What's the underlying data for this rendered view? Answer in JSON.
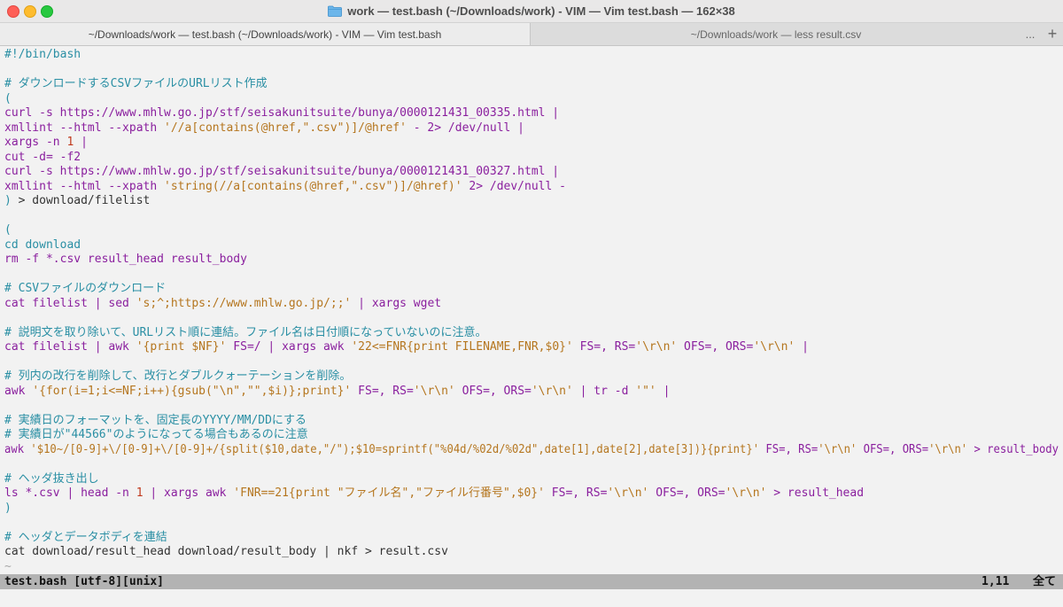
{
  "window": {
    "title": "work — test.bash (~/Downloads/work) - VIM — Vim test.bash — 162×38",
    "icon": "folder-icon"
  },
  "tabs": [
    {
      "label": "~/Downloads/work — test.bash (~/Downloads/work) - VIM — Vim test.bash"
    },
    {
      "label": "~/Downloads/work — less result.csv"
    }
  ],
  "tab_actions": {
    "overflow": "...",
    "new_tab": "+"
  },
  "colors": {
    "comment": "#2a8fa4",
    "keyword": "#2a8fa4",
    "string": "#b5761f",
    "command": "#8a1f9e",
    "number": "#c03a1e",
    "text": "#333333",
    "tilde": "#a8a8a8"
  },
  "editor": {
    "lines": [
      [
        [
          "#!/bin/bash",
          "comment"
        ]
      ],
      [],
      [
        [
          "# ダウンロードするCSVファイルのURLリスト作成",
          "comment"
        ]
      ],
      [
        [
          "(",
          "keyword"
        ]
      ],
      [
        [
          "curl -s https://www.mhlw.go.jp/stf/seisakunitsuite/bunya/0000121431_00335.html |",
          "command"
        ]
      ],
      [
        [
          "xmllint --html --xpath ",
          "command"
        ],
        [
          "'//a[contains(@href,\".csv\")]/@href'",
          "string"
        ],
        [
          " - 2> /dev/null |",
          "command"
        ]
      ],
      [
        [
          "xargs -n ",
          "command"
        ],
        [
          "1",
          "number"
        ],
        [
          " |",
          "command"
        ]
      ],
      [
        [
          "cut -d= -f2",
          "command"
        ]
      ],
      [
        [
          "curl -s https://www.mhlw.go.jp/stf/seisakunitsuite/bunya/0000121431_00327.html |",
          "command"
        ]
      ],
      [
        [
          "xmllint --html --xpath ",
          "command"
        ],
        [
          "'string(//a[contains(@href,\".csv\")]/@href)'",
          "string"
        ],
        [
          " 2> /dev/null -",
          "command"
        ]
      ],
      [
        [
          ")",
          "keyword"
        ],
        [
          " > download/filelist",
          "text"
        ]
      ],
      [],
      [
        [
          "(",
          "keyword"
        ]
      ],
      [
        [
          "cd download",
          "keyword"
        ]
      ],
      [
        [
          "rm -f *.csv result_head result_body",
          "command"
        ]
      ],
      [],
      [
        [
          "# CSVファイルのダウンロード",
          "comment"
        ]
      ],
      [
        [
          "cat filelist | sed ",
          "command"
        ],
        [
          "'s;^;https://www.mhlw.go.jp/;;'",
          "string"
        ],
        [
          " | xargs wget",
          "command"
        ]
      ],
      [],
      [
        [
          "# 説明文を取り除いて、URLリスト順に連結。ファイル名は日付順になっていないのに注意。",
          "comment"
        ]
      ],
      [
        [
          "cat filelist | awk ",
          "command"
        ],
        [
          "'{print $NF}'",
          "string"
        ],
        [
          " FS=/ | xargs awk ",
          "command"
        ],
        [
          "'22<=FNR{print FILENAME,FNR,$0}'",
          "string"
        ],
        [
          " FS=, RS=",
          "command"
        ],
        [
          "'\\r\\n'",
          "string"
        ],
        [
          " OFS=, ORS=",
          "command"
        ],
        [
          "'\\r\\n'",
          "string"
        ],
        [
          " |",
          "command"
        ]
      ],
      [],
      [
        [
          "# 列内の改行を削除して、改行とダブルクォーテーションを削除。",
          "comment"
        ]
      ],
      [
        [
          "awk ",
          "command"
        ],
        [
          "'{for(i=1;i<=NF;i++){gsub(\"\\n\",\"\",$i)};print}'",
          "string"
        ],
        [
          " FS=, RS=",
          "command"
        ],
        [
          "'\\r\\n'",
          "string"
        ],
        [
          " OFS=, ORS=",
          "command"
        ],
        [
          "'\\r\\n'",
          "string"
        ],
        [
          " | tr -d ",
          "command"
        ],
        [
          "'\"'",
          "string"
        ],
        [
          " |",
          "command"
        ]
      ],
      [],
      [
        [
          "# 実績日のフォーマットを、固定長のYYYY/MM/DDにする",
          "comment"
        ]
      ],
      [
        [
          "# 実績日が\"44566\"のようになってる場合もあるのに注意",
          "comment"
        ]
      ],
      [
        [
          "awk ",
          "command"
        ],
        [
          "'$10~/[0-9]+\\/[0-9]+\\/[0-9]+/{split($10,date,\"/\");$10=sprintf(\"%04d/%02d/%02d\",date[1],date[2],date[3])}{print}'",
          "string"
        ],
        [
          " FS=, RS=",
          "command"
        ],
        [
          "'\\r\\n'",
          "string"
        ],
        [
          " OFS=, ORS=",
          "command"
        ],
        [
          "'\\r\\n'",
          "string"
        ],
        [
          " > result_body",
          "command"
        ]
      ],
      [],
      [
        [
          "# ヘッダ抜き出し",
          "comment"
        ]
      ],
      [
        [
          "ls *.csv | head -n ",
          "command"
        ],
        [
          "1",
          "number"
        ],
        [
          " | xargs awk ",
          "command"
        ],
        [
          "'FNR==21{print \"ファイル名\",\"ファイル行番号\",$0}'",
          "string"
        ],
        [
          " FS=, RS=",
          "command"
        ],
        [
          "'\\r\\n'",
          "string"
        ],
        [
          " OFS=, ORS=",
          "command"
        ],
        [
          "'\\r\\n'",
          "string"
        ],
        [
          " > result_head",
          "command"
        ]
      ],
      [
        [
          ")",
          "keyword"
        ]
      ],
      [],
      [
        [
          "# ヘッダとデータボディを連結",
          "comment"
        ]
      ],
      [
        [
          "cat download/result_head download/result_body | nkf > result.csv",
          "text"
        ]
      ],
      [
        [
          "~",
          "tilde"
        ]
      ]
    ]
  },
  "statusbar": {
    "file_info": "test.bash [utf-8][unix]",
    "position": "1,11",
    "scroll": "全て"
  }
}
